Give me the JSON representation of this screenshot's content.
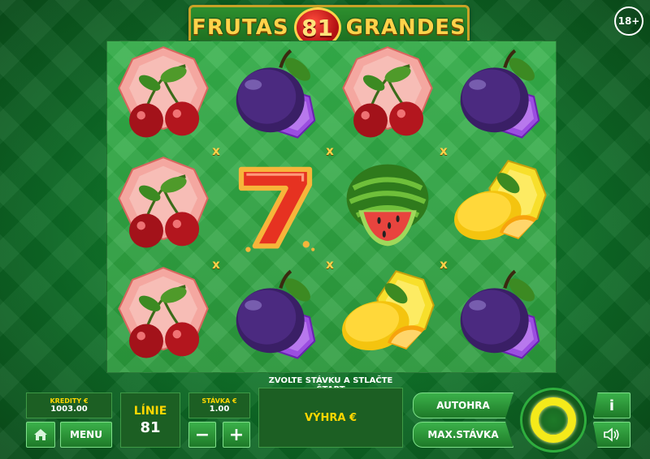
{
  "title": {
    "word1": "FRUTAS",
    "number": "81",
    "word2": "GRANDES"
  },
  "age_badge": "18+",
  "reels": {
    "grid": [
      [
        "cherry-gem",
        "plum-gem",
        "cherry-gem",
        "plum-gem"
      ],
      [
        "cherry-gem",
        "seven",
        "watermelon",
        "lemon-gem"
      ],
      [
        "cherry-gem",
        "plum-gem",
        "lemon-gem",
        "plum-gem"
      ]
    ],
    "multiplier_marker": "x"
  },
  "hint": "ZVOLTE STÁVKU A STLAČTE ŠTART",
  "panel": {
    "credits_label": "KREDITY €",
    "credits_value": "1003.00",
    "lines_label": "LÍNIE",
    "lines_value": "81",
    "bet_label": "STÁVKA €",
    "bet_value": "1.00",
    "win_label": "VÝHRA €",
    "menu_label": "MENU",
    "minus_label": "−",
    "plus_label": "+",
    "autoplay_label": "AUTOHRA",
    "maxbet_label": "MAX.STÁVKA",
    "info_label": "i",
    "home_icon": "home-icon",
    "sound_icon": "speaker-icon",
    "spin_icon": "spin-ring-icon"
  },
  "colors": {
    "accent_yellow": "#ffd700",
    "panel_green": "#1c5f23",
    "button_green": "#3bb14a",
    "spin_ring": "#f4ea1a"
  }
}
